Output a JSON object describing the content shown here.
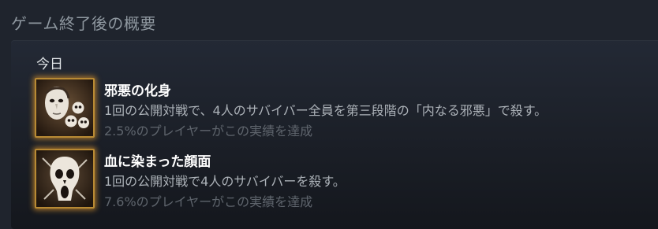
{
  "section_title": "ゲーム終了後の概要",
  "day_label": "今日",
  "achievements": [
    {
      "name": "邪悪の化身",
      "description": "1回の公開対戦で、4人のサバイバー全員を第三段階の「内なる邪悪」で殺す。",
      "percent": "2.5%のプレイヤーがこの実績を達成",
      "icon": "masked-killer-skulls-icon"
    },
    {
      "name": "血に染まった顔面",
      "description": "1回の公開対戦で4人のサバイバーを殺す。",
      "percent": "7.6%のプレイヤーがこの実績を達成",
      "icon": "screaming-skull-icon"
    }
  ],
  "colors": {
    "background": "#1f242d",
    "icon_border_glow": "#cd8c2d",
    "title_text": "#8f98a0",
    "name_text": "#ffffff",
    "desc_text": "#acb2b8",
    "percent_text": "#5f656d"
  }
}
